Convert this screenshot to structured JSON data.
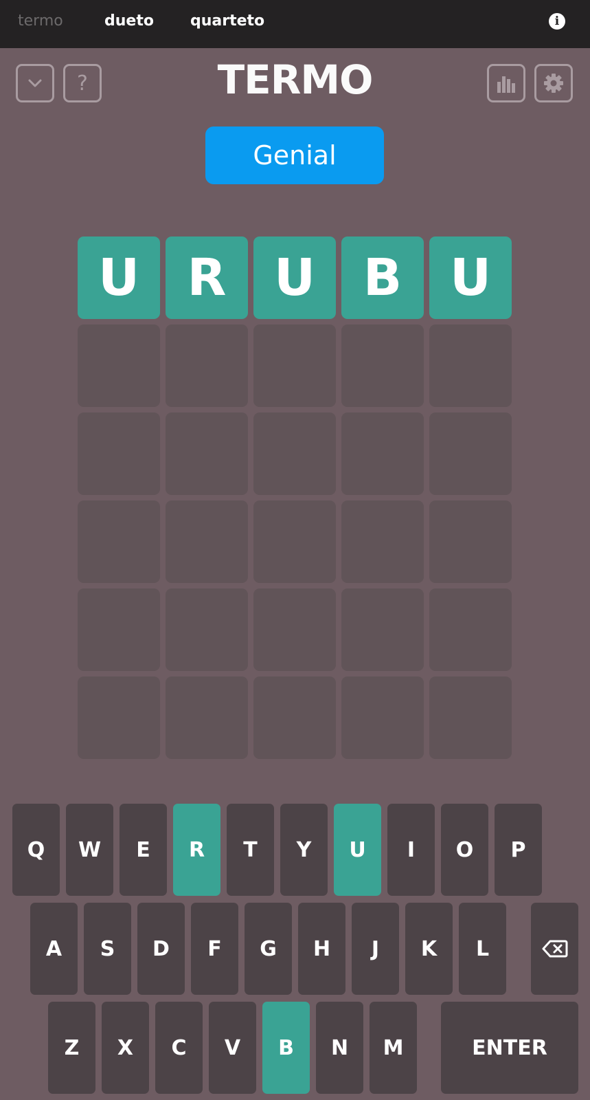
{
  "nav": {
    "termo": "termo",
    "dueto": "dueto",
    "quarteto": "quarteto"
  },
  "header": {
    "title": "TERMO"
  },
  "toast": "Genial",
  "colors": {
    "correct": "#3aa394",
    "tile_empty": "#615458",
    "key": "#4c4347",
    "background": "#6e5c62",
    "toast": "#0a9bf0"
  },
  "board": {
    "rows": [
      [
        "U",
        "R",
        "U",
        "B",
        "U"
      ],
      [
        "",
        "",
        "",
        "",
        ""
      ],
      [
        "",
        "",
        "",
        "",
        ""
      ],
      [
        "",
        "",
        "",
        "",
        ""
      ],
      [
        "",
        "",
        "",
        "",
        ""
      ],
      [
        "",
        "",
        "",
        "",
        ""
      ]
    ],
    "solved_row": 0
  },
  "keyboard": {
    "row1": [
      "Q",
      "W",
      "E",
      "R",
      "T",
      "Y",
      "U",
      "I",
      "O",
      "P"
    ],
    "row2": [
      "A",
      "S",
      "D",
      "F",
      "G",
      "H",
      "J",
      "K",
      "L"
    ],
    "row3": [
      "Z",
      "X",
      "C",
      "V",
      "B",
      "N",
      "M"
    ],
    "enter": "ENTER",
    "backspace_icon": "backspace-icon",
    "correct_keys": [
      "R",
      "U",
      "B"
    ]
  }
}
